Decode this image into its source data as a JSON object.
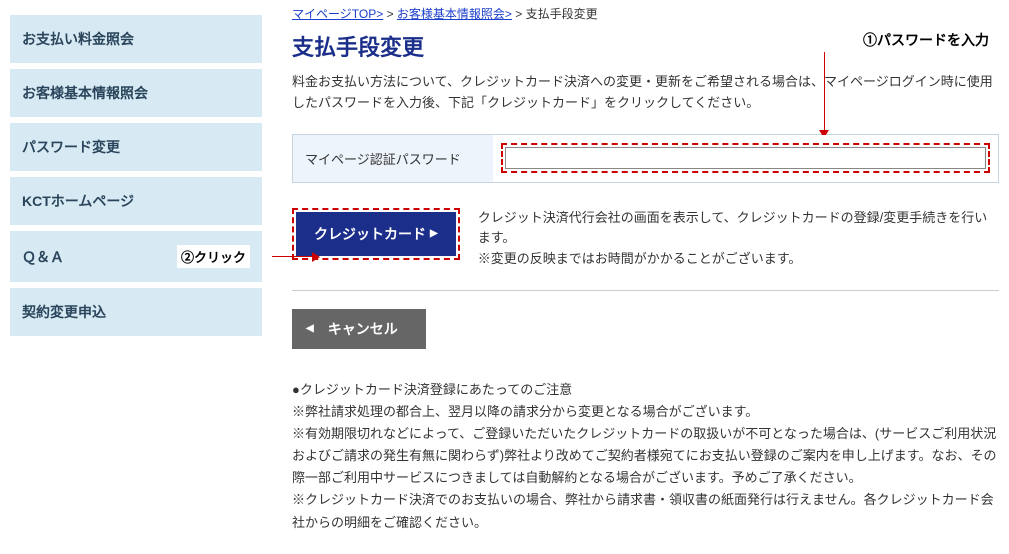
{
  "sidebar": {
    "items": [
      {
        "label": "お支払い料金照会"
      },
      {
        "label": "お客様基本情報照会"
      },
      {
        "label": "パスワード変更"
      },
      {
        "label": "KCTホームページ"
      },
      {
        "label": "Ｑ＆Ａ"
      },
      {
        "label": "契約変更申込"
      }
    ]
  },
  "annotations": {
    "step1": "①パスワードを入力",
    "step2": "②クリック"
  },
  "breadcrumb": {
    "top": "マイページTOP>",
    "sep": " > ",
    "info": "お客様基本情報照会>",
    "current": "支払手段変更"
  },
  "page_title": "支払手段変更",
  "intro": "料金お支払い方法について、クレジットカード決済への変更・更新をご希望される場合は、マイページログイン時に使用したパスワードを入力後、下記「クレジットカード」をクリックしてください。",
  "password": {
    "label": "マイページ認証パスワード",
    "value": ""
  },
  "credit_card": {
    "button": "クレジットカード",
    "desc1": "クレジット決済代行会社の画面を表示して、クレジットカードの登録/変更手続きを行います。",
    "desc2": "※変更の反映まではお時間がかかることがございます。"
  },
  "cancel_label": "キャンセル",
  "notice": {
    "heading": "●クレジットカード決済登録にあたってのご注意",
    "line1": "※弊社請求処理の都合上、翌月以降の請求分から変更となる場合がございます。",
    "line2": "※有効期限切れなどによって、ご登録いただいたクレジットカードの取扱いが不可となった場合は、(サービスご利用状況およびご請求の発生有無に関わらず)弊社より改めてご契約者様宛てにお支払い登録のご案内を申し上げます。なお、その際一部ご利用中サービスにつきましては自動解約となる場合がございます。予めご了承ください。",
    "line3": "※クレジットカード決済でのお支払いの場合、弊社から請求書・領収書の紙面発行は行えません。各クレジットカード会社からの明細をご確認ください。"
  }
}
